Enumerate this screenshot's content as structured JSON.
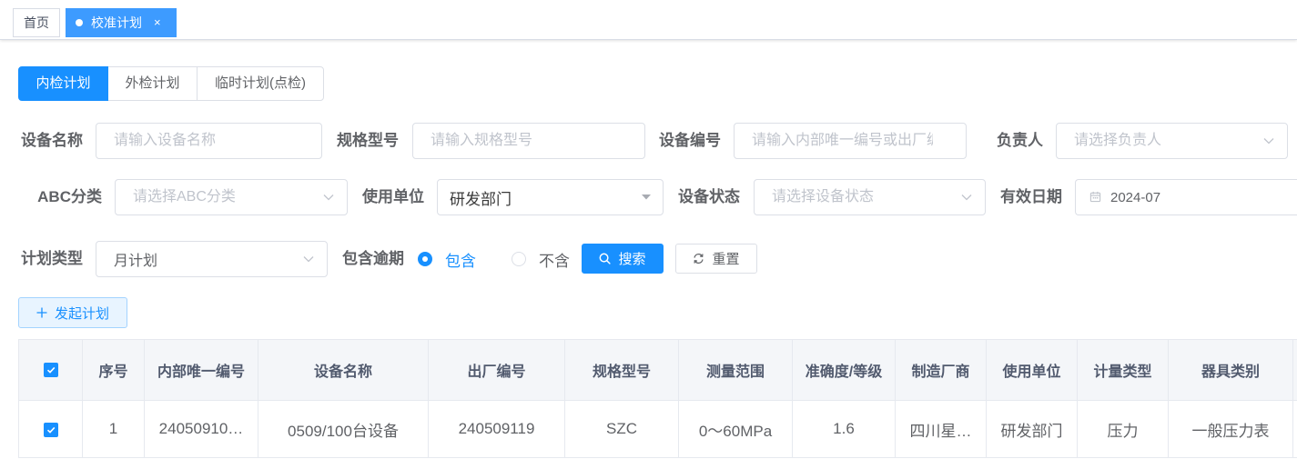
{
  "colors": {
    "accent": "#1890ff",
    "tag_active": "#3d9bff",
    "header_bg": "#f4f6f9",
    "border": "#dcdfe6",
    "table_border": "#e6e9ef",
    "plain_btn_bg": "#e8f4ff",
    "plain_btn_border": "#a3d3ff"
  },
  "tags_view": {
    "home": "首页",
    "active": {
      "label": "校准计划",
      "close": "×"
    }
  },
  "plan_tabs": [
    {
      "label": "内检计划",
      "active": true
    },
    {
      "label": "外检计划",
      "active": false
    },
    {
      "label": "临时计划(点检)",
      "active": false
    }
  ],
  "filters": {
    "device_name": {
      "label": "设备名称",
      "placeholder": "请输入设备名称"
    },
    "spec_model": {
      "label": "规格型号",
      "placeholder": "请输入规格型号"
    },
    "device_no": {
      "label": "设备编号",
      "placeholder": "请输入内部唯一编号或出厂编号"
    },
    "owner": {
      "label": "负责人",
      "placeholder": "请选择负责人"
    },
    "abc_class": {
      "label": "ABC分类",
      "placeholder": "请选择ABC分类"
    },
    "using_unit": {
      "label": "使用单位",
      "value": "研发部门"
    },
    "device_status": {
      "label": "设备状态",
      "placeholder": "请选择设备状态"
    },
    "valid_date": {
      "label": "有效日期",
      "value": "2024-07"
    },
    "plan_type": {
      "label": "计划类型",
      "value": "月计划"
    },
    "include_overdue": {
      "label": "包含逾期",
      "options": [
        {
          "label": "包含",
          "checked": true
        },
        {
          "label": "不含",
          "checked": false
        }
      ]
    }
  },
  "actions": {
    "search": "搜索",
    "reset": "重置",
    "create_plan": "发起计划"
  },
  "table": {
    "all_selected": true,
    "columns": [
      "序号",
      "内部唯一编号",
      "设备名称",
      "出厂编号",
      "规格型号",
      "测量范围",
      "准确度/等级",
      "制造厂商",
      "使用单位",
      "计量类型",
      "器具类别"
    ],
    "rows": [
      {
        "selected": true,
        "cells": [
          "1",
          "24050910…",
          "0509/100台设备",
          "240509119",
          "SZC",
          "0～60MPa",
          "1.6",
          "四川星…",
          "研发部门",
          "压力",
          "一般压力表"
        ]
      }
    ]
  },
  "icons": [
    "active-dot-icon",
    "close-icon",
    "chevron-down-icon",
    "caret-down-icon",
    "calendar-icon",
    "radio-icon",
    "search-icon",
    "refresh-icon",
    "plus-icon",
    "check-icon"
  ]
}
